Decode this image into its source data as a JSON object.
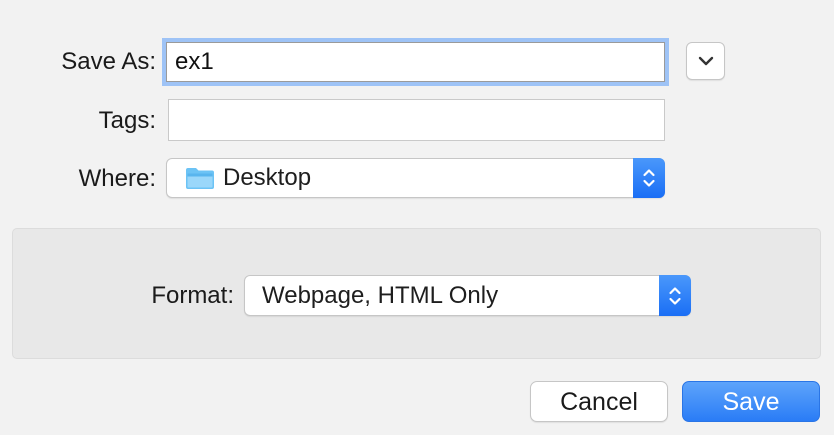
{
  "form": {
    "save_as_label": "Save As:",
    "save_as_value": "ex1",
    "tags_label": "Tags:",
    "tags_value": "",
    "where_label": "Where:",
    "where_value": "Desktop",
    "format_label": "Format:",
    "format_value": "Webpage, HTML Only"
  },
  "buttons": {
    "cancel": "Cancel",
    "save": "Save"
  },
  "icons": {
    "expand": "chevron-down-icon",
    "location": "folder-icon",
    "popup_arrows": "up-down-chevron-icon"
  },
  "colors": {
    "accent": "#1a6ef5",
    "focus_ring": "#9ec3f6",
    "folder": "#6cc3f5"
  }
}
